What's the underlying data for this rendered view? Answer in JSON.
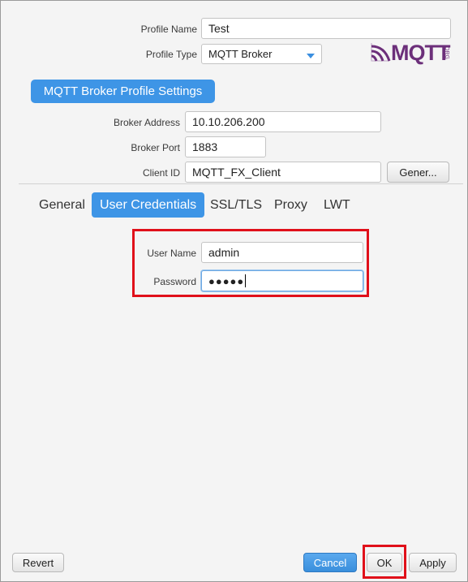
{
  "profile": {
    "name_label": "Profile Name",
    "name_value": "Test",
    "type_label": "Profile Type",
    "type_value": "MQTT Broker",
    "logo_text": "MQTT",
    "logo_sub": ".ORG"
  },
  "broker": {
    "header": "MQTT Broker Profile Settings",
    "address_label": "Broker Address",
    "address_value": "10.10.206.200",
    "port_label": "Broker Port",
    "port_value": "1883",
    "client_label": "Client ID",
    "client_value": "MQTT_FX_Client",
    "generate_label": "Gener..."
  },
  "tabs": [
    {
      "label": "General"
    },
    {
      "label": "User Credentials"
    },
    {
      "label": "SSL/TLS"
    },
    {
      "label": "Proxy"
    },
    {
      "label": "LWT"
    }
  ],
  "credentials": {
    "user_label": "User Name",
    "user_value": "admin",
    "password_label": "Password",
    "password_dots": "●●●●●"
  },
  "footer": {
    "revert": "Revert",
    "cancel": "Cancel",
    "ok": "OK",
    "apply": "Apply"
  },
  "colors": {
    "accent": "#3e95e6",
    "highlight": "#e0101a"
  }
}
